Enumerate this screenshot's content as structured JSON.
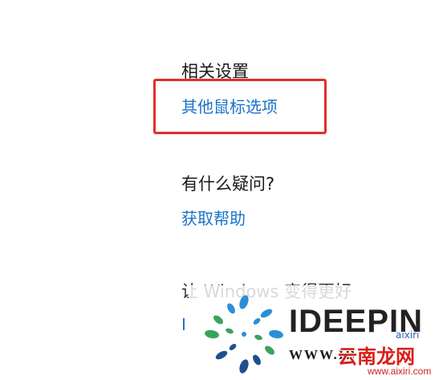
{
  "settings": {
    "related_heading": "相关设置",
    "mouse_options_link": "其他鼠标选项",
    "question_heading": "有什么疑问?",
    "get_help_link": "获取帮助",
    "improve_heading": "让 Windows 变得更好",
    "feedback_link": "I"
  },
  "watermark": {
    "brand": "IDEEPIN",
    "url_left": "WWW.ID",
    "site_name": "云南龙网",
    "site_url": "www.aixiri.com",
    "small_text": "aixiri"
  },
  "colors": {
    "link": "#1a73c8",
    "highlight": "#e0302a",
    "site_red": "#d91e18"
  }
}
